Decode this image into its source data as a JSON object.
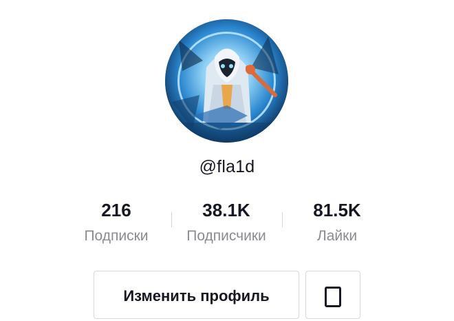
{
  "profile": {
    "username": "@fla1d",
    "avatar_icon": "profile-avatar-image"
  },
  "stats": [
    {
      "value": "216",
      "label": "Подписки"
    },
    {
      "value": "38.1K",
      "label": "Подписчики"
    },
    {
      "value": "81.5K",
      "label": "Лайки"
    }
  ],
  "actions": {
    "edit_profile_label": "Изменить профиль",
    "secondary_icon": "phone-icon"
  },
  "colors": {
    "text_primary": "#161823",
    "text_secondary": "#8a8b91",
    "border": "#d8d8dc",
    "avatar_blue": "#2f8fd6"
  }
}
